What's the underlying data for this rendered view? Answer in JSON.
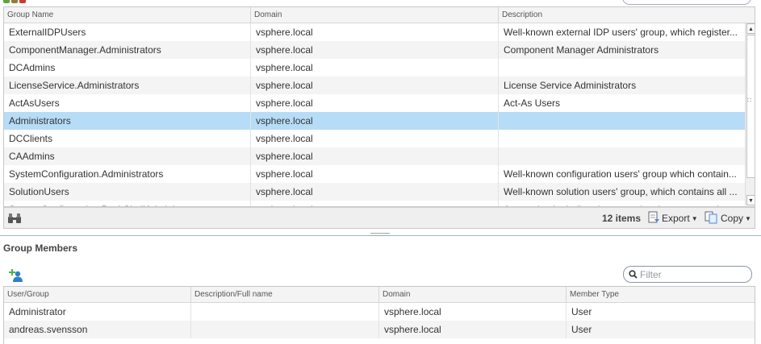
{
  "colors": {
    "selected_row": "#b6dcf7",
    "alt_row": "#f4f4f4",
    "header_bg": "#f4f4f4",
    "splitter": "#9bb7c9"
  },
  "groups_table": {
    "columns": [
      "Group Name",
      "Domain",
      "Description"
    ],
    "rows": [
      {
        "name": "ExternalIDPUsers",
        "domain": "vsphere.local",
        "description": "Well-known external IDP users' group, which register..."
      },
      {
        "name": "ComponentManager.Administrators",
        "domain": "vsphere.local",
        "description": "Component Manager Administrators"
      },
      {
        "name": "DCAdmins",
        "domain": "vsphere.local",
        "description": ""
      },
      {
        "name": "LicenseService.Administrators",
        "domain": "vsphere.local",
        "description": "License Service Administrators"
      },
      {
        "name": "ActAsUsers",
        "domain": "vsphere.local",
        "description": "Act-As Users"
      },
      {
        "name": "Administrators",
        "domain": "vsphere.local",
        "description": ""
      },
      {
        "name": "DCClients",
        "domain": "vsphere.local",
        "description": ""
      },
      {
        "name": "CAAdmins",
        "domain": "vsphere.local",
        "description": ""
      },
      {
        "name": "SystemConfiguration.Administrators",
        "domain": "vsphere.local",
        "description": "Well-known configuration users' group which contain..."
      },
      {
        "name": "SolutionUsers",
        "domain": "vsphere.local",
        "description": "Well-known solution users' group, which contains all ..."
      },
      {
        "name": "SystemConfiguration.BashShellAdministrators",
        "domain": "vsphere.local",
        "description": "Access bash shell and manage local users on nodes"
      }
    ],
    "selected_index": 5,
    "footer": {
      "count": "12 items",
      "export_label": "Export",
      "copy_label": "Copy"
    }
  },
  "group_members": {
    "title": "Group Members",
    "filter_placeholder": "Filter",
    "columns": [
      "User/Group",
      "Description/Full name",
      "Domain",
      "Member Type"
    ],
    "rows": [
      {
        "user": "Administrator",
        "description": "",
        "domain": "vsphere.local",
        "type": "User"
      },
      {
        "user": "andreas.svensson",
        "description": "",
        "domain": "vsphere.local",
        "type": "User"
      }
    ]
  }
}
